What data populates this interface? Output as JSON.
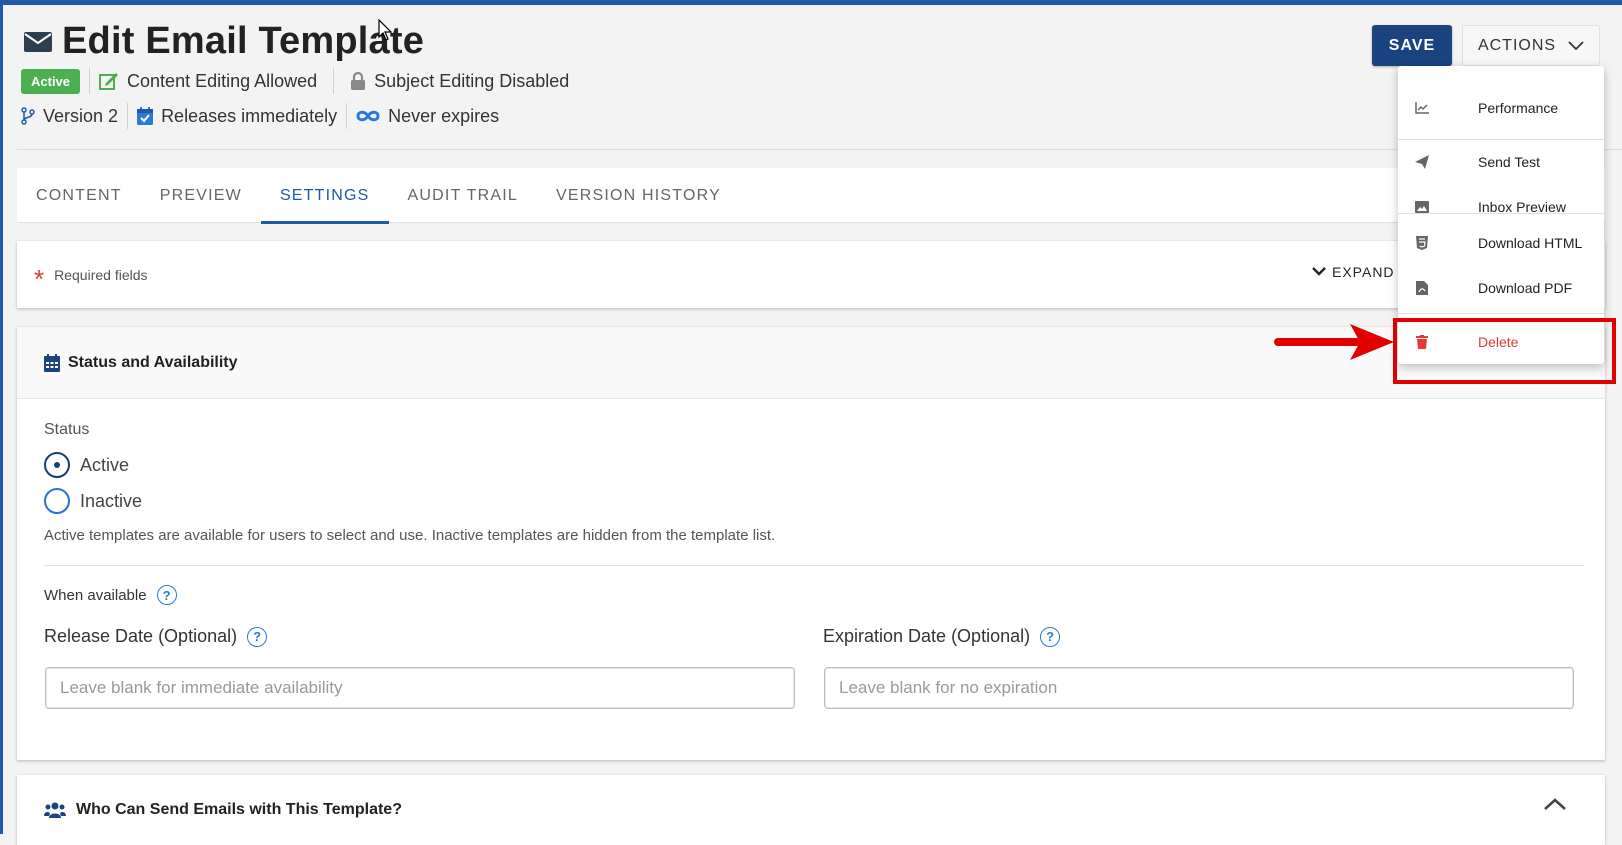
{
  "header": {
    "title": "Edit Email Template",
    "badge": "Active",
    "content_editing": "Content Editing Allowed",
    "subject_editing": "Subject Editing Disabled",
    "version": "Version 2",
    "release": "Releases immediately",
    "expiry": "Never expires",
    "save_label": "SAVE",
    "actions_label": "ACTIONS"
  },
  "tabs": [
    {
      "label": "CONTENT",
      "active": false
    },
    {
      "label": "PREVIEW",
      "active": false
    },
    {
      "label": "SETTINGS",
      "active": true
    },
    {
      "label": "AUDIT TRAIL",
      "active": false
    },
    {
      "label": "VERSION HISTORY",
      "active": false
    }
  ],
  "required": {
    "star": "*",
    "text": "Required fields",
    "expand_all": "EXPAND AL"
  },
  "status_section": {
    "title": "Status and Availability",
    "status_label": "Status",
    "options": [
      {
        "label": "Active",
        "selected": true
      },
      {
        "label": "Inactive",
        "selected": false
      }
    ],
    "help": "Active templates are available for users to select and use. Inactive templates are hidden from the template list.",
    "when_available": "When available",
    "help_icon_glyph": "?",
    "release_label": "Release Date (Optional)",
    "release_placeholder": "Leave blank for immediate availability",
    "expiration_label": "Expiration Date (Optional)",
    "expiration_placeholder": "Leave blank for no expiration"
  },
  "who_section": {
    "title": "Who Can Send Emails with This Template?"
  },
  "actions_menu": {
    "items": [
      {
        "label": "Performance",
        "icon": "chart-line-icon"
      },
      {
        "label": "Send Test",
        "icon": "paper-plane-icon"
      },
      {
        "label": "Inbox Preview",
        "icon": "image-icon"
      },
      {
        "label": "Download HTML",
        "icon": "html5-icon"
      },
      {
        "label": "Download PDF",
        "icon": "pdf-file-icon"
      },
      {
        "label": "Delete",
        "icon": "trash-icon"
      }
    ]
  },
  "colors": {
    "primary": "#1f5aa8",
    "save_button": "#1a4380",
    "active_badge": "#4caf50",
    "danger": "#e53935",
    "annotation": "#e00000"
  }
}
